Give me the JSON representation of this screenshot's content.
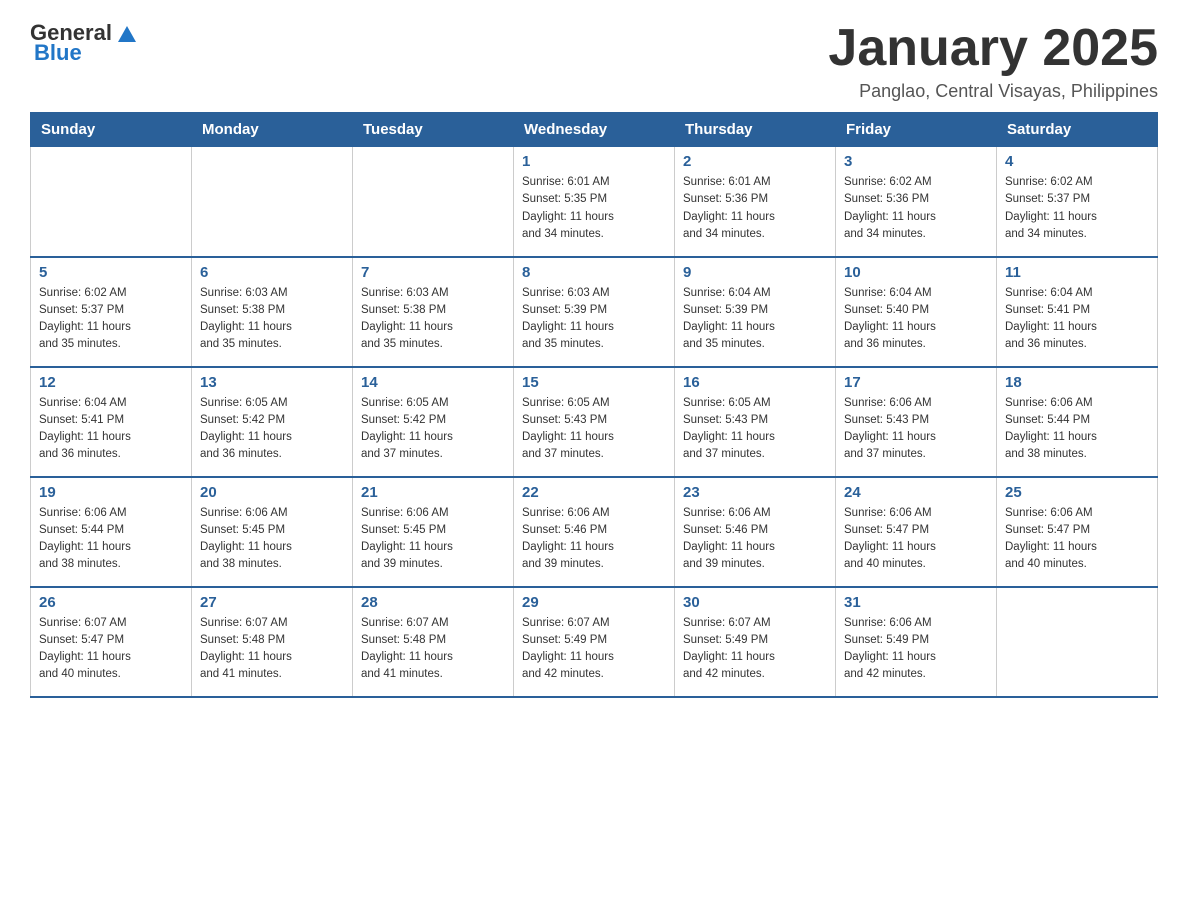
{
  "header": {
    "logo_text_general": "General",
    "logo_text_blue": "Blue",
    "month_title": "January 2025",
    "location": "Panglao, Central Visayas, Philippines"
  },
  "days_of_week": [
    "Sunday",
    "Monday",
    "Tuesday",
    "Wednesday",
    "Thursday",
    "Friday",
    "Saturday"
  ],
  "weeks": [
    [
      {
        "day": "",
        "info": ""
      },
      {
        "day": "",
        "info": ""
      },
      {
        "day": "",
        "info": ""
      },
      {
        "day": "1",
        "info": "Sunrise: 6:01 AM\nSunset: 5:35 PM\nDaylight: 11 hours\nand 34 minutes."
      },
      {
        "day": "2",
        "info": "Sunrise: 6:01 AM\nSunset: 5:36 PM\nDaylight: 11 hours\nand 34 minutes."
      },
      {
        "day": "3",
        "info": "Sunrise: 6:02 AM\nSunset: 5:36 PM\nDaylight: 11 hours\nand 34 minutes."
      },
      {
        "day": "4",
        "info": "Sunrise: 6:02 AM\nSunset: 5:37 PM\nDaylight: 11 hours\nand 34 minutes."
      }
    ],
    [
      {
        "day": "5",
        "info": "Sunrise: 6:02 AM\nSunset: 5:37 PM\nDaylight: 11 hours\nand 35 minutes."
      },
      {
        "day": "6",
        "info": "Sunrise: 6:03 AM\nSunset: 5:38 PM\nDaylight: 11 hours\nand 35 minutes."
      },
      {
        "day": "7",
        "info": "Sunrise: 6:03 AM\nSunset: 5:38 PM\nDaylight: 11 hours\nand 35 minutes."
      },
      {
        "day": "8",
        "info": "Sunrise: 6:03 AM\nSunset: 5:39 PM\nDaylight: 11 hours\nand 35 minutes."
      },
      {
        "day": "9",
        "info": "Sunrise: 6:04 AM\nSunset: 5:39 PM\nDaylight: 11 hours\nand 35 minutes."
      },
      {
        "day": "10",
        "info": "Sunrise: 6:04 AM\nSunset: 5:40 PM\nDaylight: 11 hours\nand 36 minutes."
      },
      {
        "day": "11",
        "info": "Sunrise: 6:04 AM\nSunset: 5:41 PM\nDaylight: 11 hours\nand 36 minutes."
      }
    ],
    [
      {
        "day": "12",
        "info": "Sunrise: 6:04 AM\nSunset: 5:41 PM\nDaylight: 11 hours\nand 36 minutes."
      },
      {
        "day": "13",
        "info": "Sunrise: 6:05 AM\nSunset: 5:42 PM\nDaylight: 11 hours\nand 36 minutes."
      },
      {
        "day": "14",
        "info": "Sunrise: 6:05 AM\nSunset: 5:42 PM\nDaylight: 11 hours\nand 37 minutes."
      },
      {
        "day": "15",
        "info": "Sunrise: 6:05 AM\nSunset: 5:43 PM\nDaylight: 11 hours\nand 37 minutes."
      },
      {
        "day": "16",
        "info": "Sunrise: 6:05 AM\nSunset: 5:43 PM\nDaylight: 11 hours\nand 37 minutes."
      },
      {
        "day": "17",
        "info": "Sunrise: 6:06 AM\nSunset: 5:43 PM\nDaylight: 11 hours\nand 37 minutes."
      },
      {
        "day": "18",
        "info": "Sunrise: 6:06 AM\nSunset: 5:44 PM\nDaylight: 11 hours\nand 38 minutes."
      }
    ],
    [
      {
        "day": "19",
        "info": "Sunrise: 6:06 AM\nSunset: 5:44 PM\nDaylight: 11 hours\nand 38 minutes."
      },
      {
        "day": "20",
        "info": "Sunrise: 6:06 AM\nSunset: 5:45 PM\nDaylight: 11 hours\nand 38 minutes."
      },
      {
        "day": "21",
        "info": "Sunrise: 6:06 AM\nSunset: 5:45 PM\nDaylight: 11 hours\nand 39 minutes."
      },
      {
        "day": "22",
        "info": "Sunrise: 6:06 AM\nSunset: 5:46 PM\nDaylight: 11 hours\nand 39 minutes."
      },
      {
        "day": "23",
        "info": "Sunrise: 6:06 AM\nSunset: 5:46 PM\nDaylight: 11 hours\nand 39 minutes."
      },
      {
        "day": "24",
        "info": "Sunrise: 6:06 AM\nSunset: 5:47 PM\nDaylight: 11 hours\nand 40 minutes."
      },
      {
        "day": "25",
        "info": "Sunrise: 6:06 AM\nSunset: 5:47 PM\nDaylight: 11 hours\nand 40 minutes."
      }
    ],
    [
      {
        "day": "26",
        "info": "Sunrise: 6:07 AM\nSunset: 5:47 PM\nDaylight: 11 hours\nand 40 minutes."
      },
      {
        "day": "27",
        "info": "Sunrise: 6:07 AM\nSunset: 5:48 PM\nDaylight: 11 hours\nand 41 minutes."
      },
      {
        "day": "28",
        "info": "Sunrise: 6:07 AM\nSunset: 5:48 PM\nDaylight: 11 hours\nand 41 minutes."
      },
      {
        "day": "29",
        "info": "Sunrise: 6:07 AM\nSunset: 5:49 PM\nDaylight: 11 hours\nand 42 minutes."
      },
      {
        "day": "30",
        "info": "Sunrise: 6:07 AM\nSunset: 5:49 PM\nDaylight: 11 hours\nand 42 minutes."
      },
      {
        "day": "31",
        "info": "Sunrise: 6:06 AM\nSunset: 5:49 PM\nDaylight: 11 hours\nand 42 minutes."
      },
      {
        "day": "",
        "info": ""
      }
    ]
  ]
}
